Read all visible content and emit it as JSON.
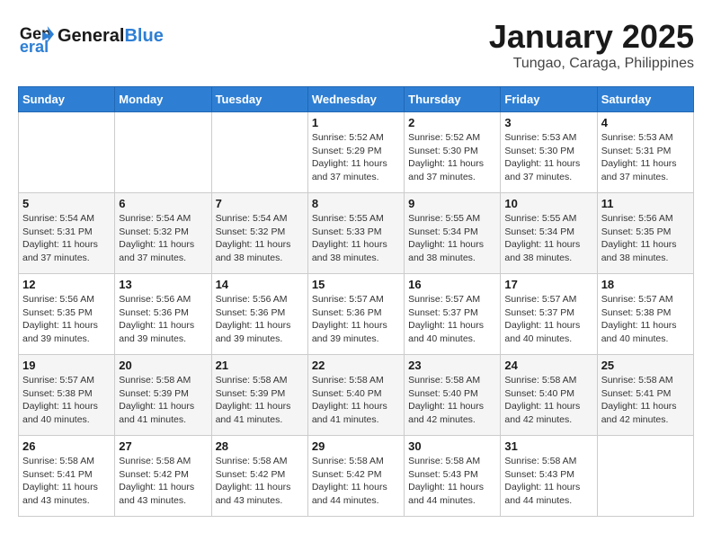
{
  "header": {
    "logo_line1": "General",
    "logo_line2": "Blue",
    "month_year": "January 2025",
    "location": "Tungao, Caraga, Philippines"
  },
  "weekdays": [
    "Sunday",
    "Monday",
    "Tuesday",
    "Wednesday",
    "Thursday",
    "Friday",
    "Saturday"
  ],
  "weeks": [
    [
      {
        "day": "",
        "info": ""
      },
      {
        "day": "",
        "info": ""
      },
      {
        "day": "",
        "info": ""
      },
      {
        "day": "1",
        "info": "Sunrise: 5:52 AM\nSunset: 5:29 PM\nDaylight: 11 hours\nand 37 minutes."
      },
      {
        "day": "2",
        "info": "Sunrise: 5:52 AM\nSunset: 5:30 PM\nDaylight: 11 hours\nand 37 minutes."
      },
      {
        "day": "3",
        "info": "Sunrise: 5:53 AM\nSunset: 5:30 PM\nDaylight: 11 hours\nand 37 minutes."
      },
      {
        "day": "4",
        "info": "Sunrise: 5:53 AM\nSunset: 5:31 PM\nDaylight: 11 hours\nand 37 minutes."
      }
    ],
    [
      {
        "day": "5",
        "info": "Sunrise: 5:54 AM\nSunset: 5:31 PM\nDaylight: 11 hours\nand 37 minutes."
      },
      {
        "day": "6",
        "info": "Sunrise: 5:54 AM\nSunset: 5:32 PM\nDaylight: 11 hours\nand 37 minutes."
      },
      {
        "day": "7",
        "info": "Sunrise: 5:54 AM\nSunset: 5:32 PM\nDaylight: 11 hours\nand 38 minutes."
      },
      {
        "day": "8",
        "info": "Sunrise: 5:55 AM\nSunset: 5:33 PM\nDaylight: 11 hours\nand 38 minutes."
      },
      {
        "day": "9",
        "info": "Sunrise: 5:55 AM\nSunset: 5:34 PM\nDaylight: 11 hours\nand 38 minutes."
      },
      {
        "day": "10",
        "info": "Sunrise: 5:55 AM\nSunset: 5:34 PM\nDaylight: 11 hours\nand 38 minutes."
      },
      {
        "day": "11",
        "info": "Sunrise: 5:56 AM\nSunset: 5:35 PM\nDaylight: 11 hours\nand 38 minutes."
      }
    ],
    [
      {
        "day": "12",
        "info": "Sunrise: 5:56 AM\nSunset: 5:35 PM\nDaylight: 11 hours\nand 39 minutes."
      },
      {
        "day": "13",
        "info": "Sunrise: 5:56 AM\nSunset: 5:36 PM\nDaylight: 11 hours\nand 39 minutes."
      },
      {
        "day": "14",
        "info": "Sunrise: 5:56 AM\nSunset: 5:36 PM\nDaylight: 11 hours\nand 39 minutes."
      },
      {
        "day": "15",
        "info": "Sunrise: 5:57 AM\nSunset: 5:36 PM\nDaylight: 11 hours\nand 39 minutes."
      },
      {
        "day": "16",
        "info": "Sunrise: 5:57 AM\nSunset: 5:37 PM\nDaylight: 11 hours\nand 40 minutes."
      },
      {
        "day": "17",
        "info": "Sunrise: 5:57 AM\nSunset: 5:37 PM\nDaylight: 11 hours\nand 40 minutes."
      },
      {
        "day": "18",
        "info": "Sunrise: 5:57 AM\nSunset: 5:38 PM\nDaylight: 11 hours\nand 40 minutes."
      }
    ],
    [
      {
        "day": "19",
        "info": "Sunrise: 5:57 AM\nSunset: 5:38 PM\nDaylight: 11 hours\nand 40 minutes."
      },
      {
        "day": "20",
        "info": "Sunrise: 5:58 AM\nSunset: 5:39 PM\nDaylight: 11 hours\nand 41 minutes."
      },
      {
        "day": "21",
        "info": "Sunrise: 5:58 AM\nSunset: 5:39 PM\nDaylight: 11 hours\nand 41 minutes."
      },
      {
        "day": "22",
        "info": "Sunrise: 5:58 AM\nSunset: 5:40 PM\nDaylight: 11 hours\nand 41 minutes."
      },
      {
        "day": "23",
        "info": "Sunrise: 5:58 AM\nSunset: 5:40 PM\nDaylight: 11 hours\nand 42 minutes."
      },
      {
        "day": "24",
        "info": "Sunrise: 5:58 AM\nSunset: 5:40 PM\nDaylight: 11 hours\nand 42 minutes."
      },
      {
        "day": "25",
        "info": "Sunrise: 5:58 AM\nSunset: 5:41 PM\nDaylight: 11 hours\nand 42 minutes."
      }
    ],
    [
      {
        "day": "26",
        "info": "Sunrise: 5:58 AM\nSunset: 5:41 PM\nDaylight: 11 hours\nand 43 minutes."
      },
      {
        "day": "27",
        "info": "Sunrise: 5:58 AM\nSunset: 5:42 PM\nDaylight: 11 hours\nand 43 minutes."
      },
      {
        "day": "28",
        "info": "Sunrise: 5:58 AM\nSunset: 5:42 PM\nDaylight: 11 hours\nand 43 minutes."
      },
      {
        "day": "29",
        "info": "Sunrise: 5:58 AM\nSunset: 5:42 PM\nDaylight: 11 hours\nand 44 minutes."
      },
      {
        "day": "30",
        "info": "Sunrise: 5:58 AM\nSunset: 5:43 PM\nDaylight: 11 hours\nand 44 minutes."
      },
      {
        "day": "31",
        "info": "Sunrise: 5:58 AM\nSunset: 5:43 PM\nDaylight: 11 hours\nand 44 minutes."
      },
      {
        "day": "",
        "info": ""
      }
    ]
  ]
}
